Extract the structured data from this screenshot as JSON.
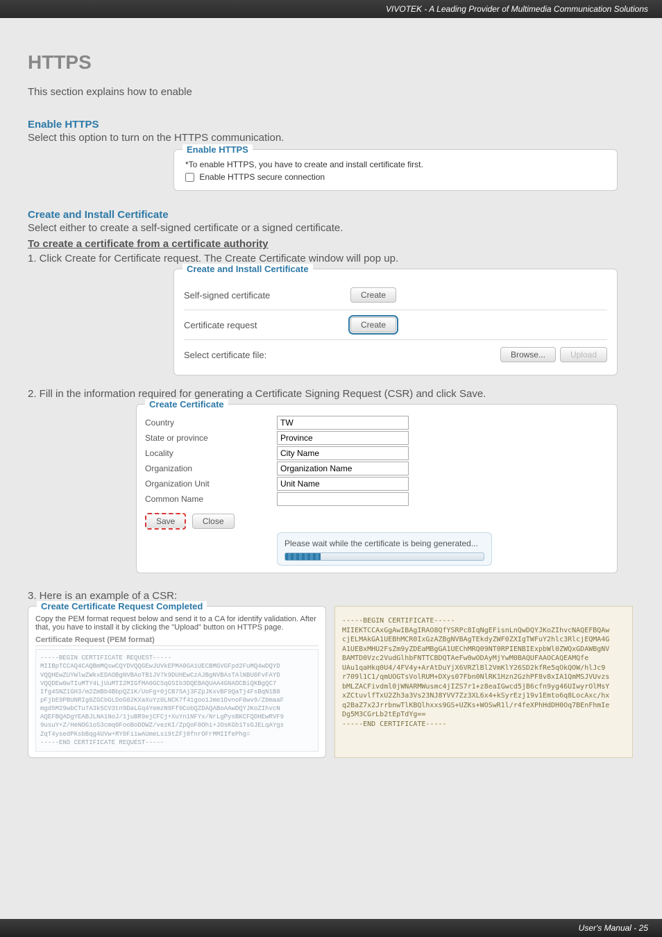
{
  "header": {
    "tagline": "VIVOTEK - A Leading Provider of Multimedia Communication Solutions"
  },
  "title": "HTTPS",
  "intro": "This section explains how to enable",
  "s1": {
    "heading": "Enable HTTPS",
    "text": "Select this option to turn on the HTTPS communication.",
    "panel_legend": "Enable HTTPS",
    "note": "*To enable HTTPS, you have to create and install certificate first.",
    "checkbox_label": "Enable HTTPS secure connection"
  },
  "s2": {
    "heading": "Create and Install Certificate",
    "text": "Select either to create a self-signed certificate or a signed certificate."
  },
  "s3": {
    "to_create": "To create a certificate from a certificate authority",
    "step1": "1. Click Create for Certificate request. The Create Certificate window will pop up.",
    "panel_legend": "Create and Install Certificate",
    "row1_label": "Self-signed certificate",
    "row1_btn": "Create",
    "row2_label": "Certificate request",
    "row2_btn": "Create",
    "row3_label": "Select certificate file:",
    "browse_btn": "Browse...",
    "upload_btn": "Upload"
  },
  "s4": {
    "step2": "2. Fill in the information required for generating a Certificate Signing Request (CSR) and click Save.",
    "panel_legend": "Create Certificate",
    "fields": {
      "country_lbl": "Country",
      "country_val": "TW",
      "state_lbl": "State or province",
      "state_val": "Province",
      "locality_lbl": "Locality",
      "locality_val": "City Name",
      "org_lbl": "Organization",
      "org_val": "Organization Name",
      "ou_lbl": "Organization Unit",
      "ou_val": "Unit Name",
      "cn_lbl": "Common Name",
      "cn_val": ""
    },
    "save_btn": "Save",
    "close_btn": "Close",
    "gen_msg": "Please wait while the certificate is being generated..."
  },
  "s5": {
    "step3": "3. Here is an example of a CSR:",
    "left_legend": "Create Certificate Request Completed",
    "instr": "Copy the PEM format request below and send it to a CA for identify validation. After that, you have to install it by clicking the \"Upload\" button on HTTPS page.",
    "sub": "Certificate Request (PEM format)",
    "left_block": "-----BEGIN CERTIFICATE REQUEST-----\nMIIBpTCCAQ4CAQBmMQswCQYDVQQGEwJUVkEPMA0GA1UECBMGVGFpd2FuMQ4wDQYD\nVQQHEwZUYWlwZWkxEDAOBgNVBAoTB1JV7k9DUHEwCzAJBgNVBAsTAlNBU0FvFAYD\nVQQDEw0wTIuMTY4LjUuMTI2MIGfMA0GCSqGSIb3DQEBAQUAA4GNADCBiQKBgQC7\nIfg4SNZ1GH3/m2ZmBb4BbpQZ1K/UoFg+0jCB7SAj3FZpJKxvBF9QaTj4FsBqN1B8\npFjbE9PBUNRIg0ZGCbGLDoG02KXaXuYz0LNCK7f41goo1Jme1DvnoF0wv9/Z0maaF\nmgd5M29wbCTu7A3k5CV3tn9DaLGq4YemzN9Ff0CobQZDAQABoAAwDQYJKoZIhvcN\nAQEFBQADgYEABJLNA1NoJ/1juBR9ejCFCj+XuYn1NFYx/NrLgPysBKCFQDHEwRVF9\n9usuY+Z/HeNOG1oS3cmq0FooBoDDWZ/vezKI/ZpQoF0Ohi+JOsKGb1TsGJELqAYgs\nZqT4ysedPKsbBqg4UVw+RY0FiiwAUmeLsi9tZFj8fnrOFrMMIIfePhg=\n-----END CERTIFICATE REQUEST-----",
    "right_block": "-----BEGIN CERTIFICATE-----\nMIIEKTCCAxGgAwIBAgIRAO8QfYSRPc8IqNgEFisnLnQwDQYJKoZIhvcNAQEFBQAw\ncjELMAkGA1UEBhMCR0IxGzAZBgNVBAgTEkdyZWF0ZXIgTWFuY2hlc3RlcjEQMA4G\nA1UEBxMHU2FsZm9yZDEaMBgGA1UEChMRQ09NT0RPIENBIExpbWl0ZWQxGDAWBgNV\nBAMTD0Vzc2VudGlhbFNTTCBDQTAeFw0wODAyMjYwM0BAQUFAAOCAQEAMQfe\nUAu1qaHkq0U4/4FV4y+ArAtDuYjX6VRZlBl2VmKlY26SD2kfRe5qOkQOW/hlJc9\nr709l1C1/qmUOGTsVolRUM+DXys07Fbn0NlRK1Hzn2GzhPF8v8xIA1QmMSJVUvzs\nbMLZACFivdml0jWNARMWusmc4jIZS7r1+z8eaIGwcd5jB6cfn9yg46UIwyrOlMsY\nxZCtuvlfTxU2Zh3a3Vs23NJ8YVV7Zz3XL6x4+kSyrEzj19v1Emto6q8LocAxc/hx\nq2BaZ7x2JrrbnwTlKBQlhxxs9GS+UZKs+WOSwR1l/r4feXPhHdDH0Oq7BEnFhmIe\nDg5M3CGrLb2tEpTdYg==\n-----END CERTIFICATE-----"
  },
  "footer": {
    "text": "User's Manual - 25"
  }
}
